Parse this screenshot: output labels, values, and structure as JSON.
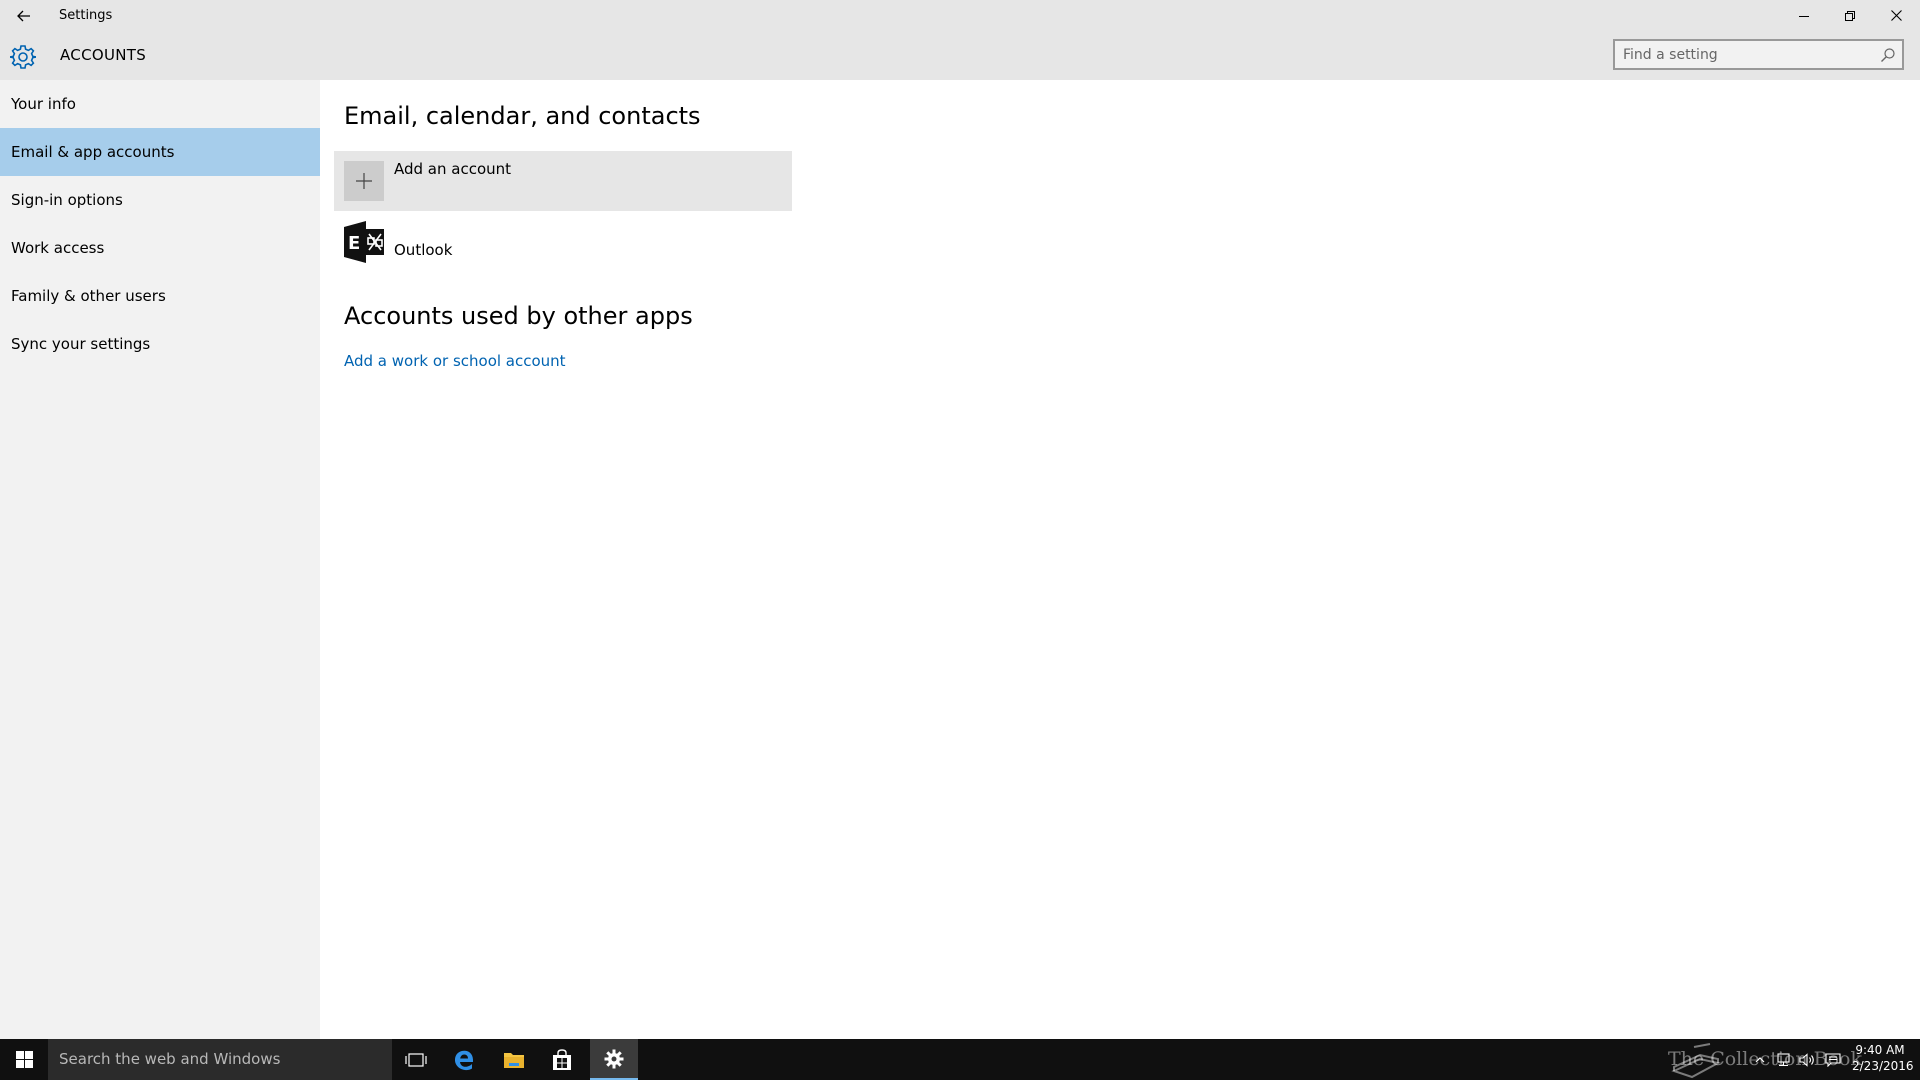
{
  "window": {
    "title": "Settings"
  },
  "header": {
    "section_title": "ACCOUNTS",
    "search_placeholder": "Find a setting"
  },
  "sidebar": {
    "items": [
      {
        "label": "Your info",
        "selected": false
      },
      {
        "label": "Email & app accounts",
        "selected": true
      },
      {
        "label": "Sign-in options",
        "selected": false
      },
      {
        "label": "Work access",
        "selected": false
      },
      {
        "label": "Family & other users",
        "selected": false
      },
      {
        "label": "Sync your settings",
        "selected": false
      }
    ]
  },
  "main": {
    "email_section": {
      "heading": "Email, calendar, and contacts",
      "add_account_label": "Add an account",
      "accounts": [
        {
          "label": "Outlook",
          "icon": "exchange-icon"
        }
      ]
    },
    "other_apps_section": {
      "heading": "Accounts used by other apps",
      "link_label": "Add a work or school account"
    }
  },
  "taskbar": {
    "search_text": "Search the web and Windows",
    "pinned": [
      {
        "name": "task-view-icon"
      },
      {
        "name": "edge-icon"
      },
      {
        "name": "file-explorer-icon"
      },
      {
        "name": "store-icon"
      },
      {
        "name": "settings-icon",
        "active": true
      }
    ],
    "clock_time": "9:40 AM",
    "clock_date": "2/23/2016",
    "watermark": "The Collection Book"
  },
  "colors": {
    "accent": "#0063b1",
    "selected_nav": "#a6cdeb",
    "chrome": "#e6e6e6",
    "sidebar_bg": "#f2f2f2",
    "taskbar_bg": "#101010"
  }
}
